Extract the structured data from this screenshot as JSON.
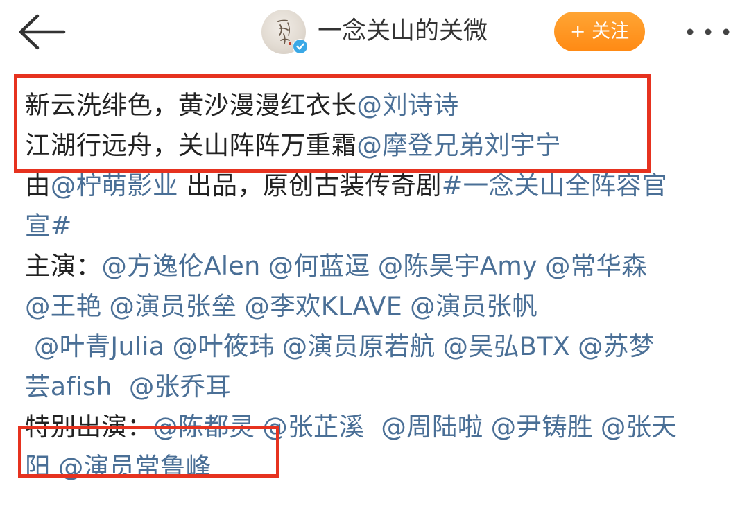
{
  "header": {
    "account_name": "一念关山的关微",
    "follow_label": "+ 关注",
    "back_icon": "back-arrow-icon",
    "more_icon": "more-dots-icon",
    "verified_icon": "verified-badge-icon",
    "avatar_calligraphy": "一念关山",
    "accent_color": "#ff8f17",
    "verified_color": "#3aa8e6"
  },
  "post": {
    "line1": {
      "text": "新云洗绯色，黄沙漫漫红衣长",
      "mention": "@刘诗诗"
    },
    "line2": {
      "text": "江湖行远舟，关山阵阵万重霜",
      "mention": "@摩登兄弟刘宇宁"
    },
    "line3": {
      "prefix": "由",
      "mention": "@柠萌影业",
      "middle": " 出品，原创古装传奇剧",
      "hashtag_part1": "#一念关山全阵容官"
    },
    "line4": {
      "hashtag_part2": "宣#"
    },
    "line5": {
      "label": "主演：",
      "mentions": [
        "@方逸伦Alen",
        "@何蓝逗",
        "@陈昊宇Amy",
        "@常华森"
      ]
    },
    "line6": {
      "mentions": [
        "@王艳",
        "@演员张垒",
        "@李欢KLAVE",
        "@演员张帆"
      ]
    },
    "line7": {
      "mentions": [
        "@叶青Julia",
        "@叶筱玮",
        "@演员原若航",
        "@吴弘BTX",
        "@苏梦"
      ]
    },
    "line8": {
      "mentions": [
        "芸afish",
        "@张乔耳"
      ]
    },
    "line9": {
      "label": "特别出演：",
      "mentions": [
        "@陈都灵",
        "@张芷溪",
        "@周陆啦",
        "@尹铸胜",
        "@张天"
      ]
    },
    "line10": {
      "mentions": [
        "阳",
        "@演员常鲁峰"
      ]
    },
    "mention_color": "#4a6f96",
    "highlight_color": "#e6321f"
  }
}
